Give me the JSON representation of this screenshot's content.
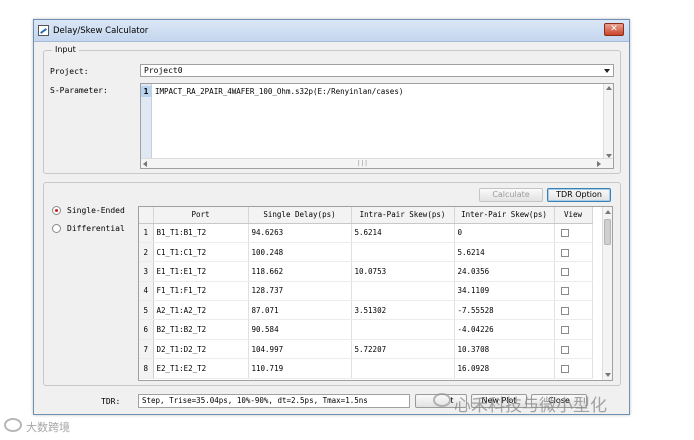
{
  "window": {
    "title": "Delay/Skew Calculator",
    "close_glyph": "✕"
  },
  "input_group": {
    "legend": "Input",
    "project_label": "Project:",
    "project_value": "Project0",
    "sparam_label": "S-Parameter:",
    "sparam_row_number": "1",
    "sparam_value": "IMPACT_RA_2PAIR_4WAFER_100_Ohm.s32p(E:/Renyinlan/cases)"
  },
  "actions": {
    "calculate_label": "Calculate",
    "tdr_option_label": "TDR Option"
  },
  "mode": {
    "single_ended": "Single-Ended",
    "differential": "Differential",
    "selected": "single_ended"
  },
  "table": {
    "columns": [
      "Port",
      "Single Delay(ps)",
      "Intra-Pair Skew(ps)",
      "Inter-Pair Skew(ps)",
      "View"
    ],
    "rows": [
      {
        "num": "1",
        "port": "B1_T1:B1_T2",
        "single_delay": "94.6263",
        "intra_skew": "5.6214",
        "inter_skew": "0"
      },
      {
        "num": "2",
        "port": "C1_T1:C1_T2",
        "single_delay": "100.248",
        "intra_skew": "",
        "inter_skew": "5.6214"
      },
      {
        "num": "3",
        "port": "E1_T1:E1_T2",
        "single_delay": "118.662",
        "intra_skew": "10.0753",
        "inter_skew": "24.0356"
      },
      {
        "num": "4",
        "port": "F1_T1:F1_T2",
        "single_delay": "128.737",
        "intra_skew": "",
        "inter_skew": "34.1109"
      },
      {
        "num": "5",
        "port": "A2_T1:A2_T2",
        "single_delay": "87.071",
        "intra_skew": "3.51302",
        "inter_skew": "-7.55528"
      },
      {
        "num": "6",
        "port": "B2_T1:B2_T2",
        "single_delay": "90.584",
        "intra_skew": "",
        "inter_skew": "-4.04226"
      },
      {
        "num": "7",
        "port": "D2_T1:D2_T2",
        "single_delay": "104.997",
        "intra_skew": "5.72207",
        "inter_skew": "10.3708"
      },
      {
        "num": "8",
        "port": "E2_T1:E2_T2",
        "single_delay": "110.719",
        "intra_skew": "",
        "inter_skew": "16.0928"
      }
    ]
  },
  "tdr": {
    "label": "TDR:",
    "value": "Step, Trise=35.04ps, 10%-90%, dt=2.5ps, Tmax=1.5ns",
    "button_partial_1": "t",
    "button_new_plot": "New Plot",
    "button_close": "Close"
  },
  "watermarks": {
    "left": "大数跨境",
    "right": "心禾科技与微小型化"
  }
}
